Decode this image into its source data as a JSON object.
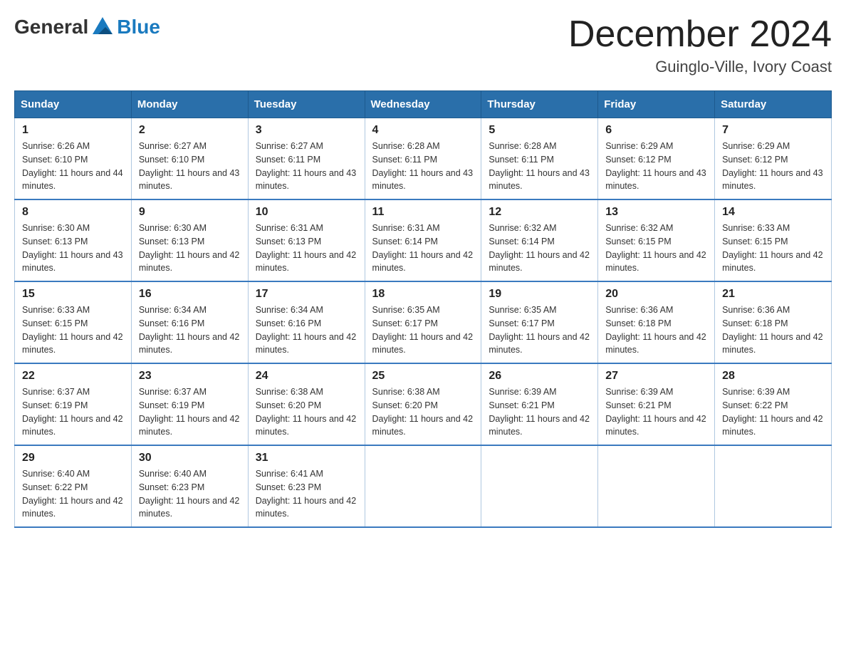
{
  "header": {
    "logo": {
      "text_general": "General",
      "text_blue": "Blue"
    },
    "title": "December 2024",
    "location": "Guinglo-Ville, Ivory Coast"
  },
  "weekdays": [
    "Sunday",
    "Monday",
    "Tuesday",
    "Wednesday",
    "Thursday",
    "Friday",
    "Saturday"
  ],
  "weeks": [
    [
      {
        "day": "1",
        "sunrise": "6:26 AM",
        "sunset": "6:10 PM",
        "daylight": "11 hours and 44 minutes."
      },
      {
        "day": "2",
        "sunrise": "6:27 AM",
        "sunset": "6:10 PM",
        "daylight": "11 hours and 43 minutes."
      },
      {
        "day": "3",
        "sunrise": "6:27 AM",
        "sunset": "6:11 PM",
        "daylight": "11 hours and 43 minutes."
      },
      {
        "day": "4",
        "sunrise": "6:28 AM",
        "sunset": "6:11 PM",
        "daylight": "11 hours and 43 minutes."
      },
      {
        "day": "5",
        "sunrise": "6:28 AM",
        "sunset": "6:11 PM",
        "daylight": "11 hours and 43 minutes."
      },
      {
        "day": "6",
        "sunrise": "6:29 AM",
        "sunset": "6:12 PM",
        "daylight": "11 hours and 43 minutes."
      },
      {
        "day": "7",
        "sunrise": "6:29 AM",
        "sunset": "6:12 PM",
        "daylight": "11 hours and 43 minutes."
      }
    ],
    [
      {
        "day": "8",
        "sunrise": "6:30 AM",
        "sunset": "6:13 PM",
        "daylight": "11 hours and 43 minutes."
      },
      {
        "day": "9",
        "sunrise": "6:30 AM",
        "sunset": "6:13 PM",
        "daylight": "11 hours and 42 minutes."
      },
      {
        "day": "10",
        "sunrise": "6:31 AM",
        "sunset": "6:13 PM",
        "daylight": "11 hours and 42 minutes."
      },
      {
        "day": "11",
        "sunrise": "6:31 AM",
        "sunset": "6:14 PM",
        "daylight": "11 hours and 42 minutes."
      },
      {
        "day": "12",
        "sunrise": "6:32 AM",
        "sunset": "6:14 PM",
        "daylight": "11 hours and 42 minutes."
      },
      {
        "day": "13",
        "sunrise": "6:32 AM",
        "sunset": "6:15 PM",
        "daylight": "11 hours and 42 minutes."
      },
      {
        "day": "14",
        "sunrise": "6:33 AM",
        "sunset": "6:15 PM",
        "daylight": "11 hours and 42 minutes."
      }
    ],
    [
      {
        "day": "15",
        "sunrise": "6:33 AM",
        "sunset": "6:15 PM",
        "daylight": "11 hours and 42 minutes."
      },
      {
        "day": "16",
        "sunrise": "6:34 AM",
        "sunset": "6:16 PM",
        "daylight": "11 hours and 42 minutes."
      },
      {
        "day": "17",
        "sunrise": "6:34 AM",
        "sunset": "6:16 PM",
        "daylight": "11 hours and 42 minutes."
      },
      {
        "day": "18",
        "sunrise": "6:35 AM",
        "sunset": "6:17 PM",
        "daylight": "11 hours and 42 minutes."
      },
      {
        "day": "19",
        "sunrise": "6:35 AM",
        "sunset": "6:17 PM",
        "daylight": "11 hours and 42 minutes."
      },
      {
        "day": "20",
        "sunrise": "6:36 AM",
        "sunset": "6:18 PM",
        "daylight": "11 hours and 42 minutes."
      },
      {
        "day": "21",
        "sunrise": "6:36 AM",
        "sunset": "6:18 PM",
        "daylight": "11 hours and 42 minutes."
      }
    ],
    [
      {
        "day": "22",
        "sunrise": "6:37 AM",
        "sunset": "6:19 PM",
        "daylight": "11 hours and 42 minutes."
      },
      {
        "day": "23",
        "sunrise": "6:37 AM",
        "sunset": "6:19 PM",
        "daylight": "11 hours and 42 minutes."
      },
      {
        "day": "24",
        "sunrise": "6:38 AM",
        "sunset": "6:20 PM",
        "daylight": "11 hours and 42 minutes."
      },
      {
        "day": "25",
        "sunrise": "6:38 AM",
        "sunset": "6:20 PM",
        "daylight": "11 hours and 42 minutes."
      },
      {
        "day": "26",
        "sunrise": "6:39 AM",
        "sunset": "6:21 PM",
        "daylight": "11 hours and 42 minutes."
      },
      {
        "day": "27",
        "sunrise": "6:39 AM",
        "sunset": "6:21 PM",
        "daylight": "11 hours and 42 minutes."
      },
      {
        "day": "28",
        "sunrise": "6:39 AM",
        "sunset": "6:22 PM",
        "daylight": "11 hours and 42 minutes."
      }
    ],
    [
      {
        "day": "29",
        "sunrise": "6:40 AM",
        "sunset": "6:22 PM",
        "daylight": "11 hours and 42 minutes."
      },
      {
        "day": "30",
        "sunrise": "6:40 AM",
        "sunset": "6:23 PM",
        "daylight": "11 hours and 42 minutes."
      },
      {
        "day": "31",
        "sunrise": "6:41 AM",
        "sunset": "6:23 PM",
        "daylight": "11 hours and 42 minutes."
      },
      null,
      null,
      null,
      null
    ]
  ]
}
